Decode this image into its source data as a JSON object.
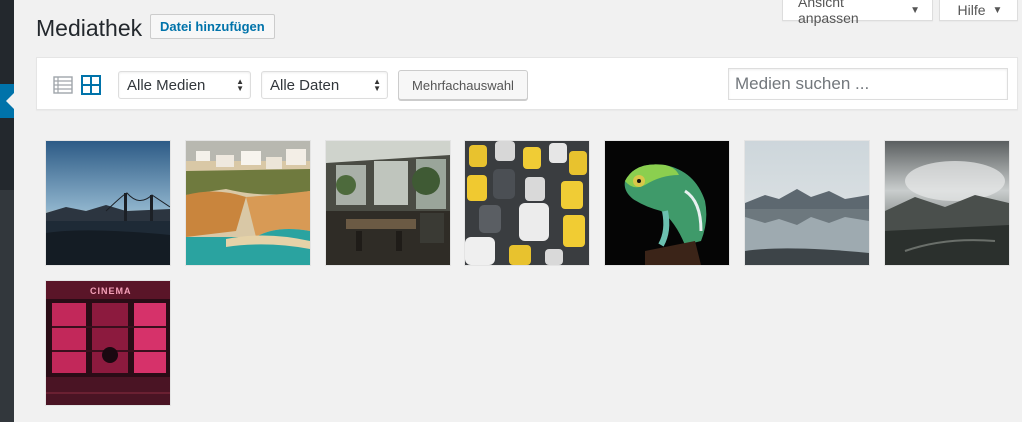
{
  "page": {
    "title": "Mediathek",
    "add_new_label": "Datei hinzufügen"
  },
  "screen_meta": {
    "screen_options_label": "Ansicht anpassen",
    "help_label": "Hilfe"
  },
  "toolbar": {
    "view_list_icon": "list-view-icon",
    "view_grid_icon": "grid-view-icon",
    "media_filter": {
      "selected": "Alle Medien"
    },
    "date_filter": {
      "selected": "Alle Daten"
    },
    "bulk_select_label": "Mehrfachauswahl",
    "search_placeholder": "Medien suchen ..."
  },
  "media_items": [
    {
      "subject": "golden-gate-bridge-dusk"
    },
    {
      "subject": "coastal-cliffs-beach-town"
    },
    {
      "subject": "greenhouse-interior-room"
    },
    {
      "subject": "traffic-jam-cars"
    },
    {
      "subject": "green-chameleon"
    },
    {
      "subject": "mountain-lake-reflection"
    },
    {
      "subject": "misty-mountain-landscape"
    },
    {
      "subject": "neon-cinema-storefront",
      "text": "CINEMA"
    }
  ],
  "colors": {
    "admin_bar": "#23282d",
    "accent": "#0073aa",
    "background": "#f1f1f1"
  }
}
